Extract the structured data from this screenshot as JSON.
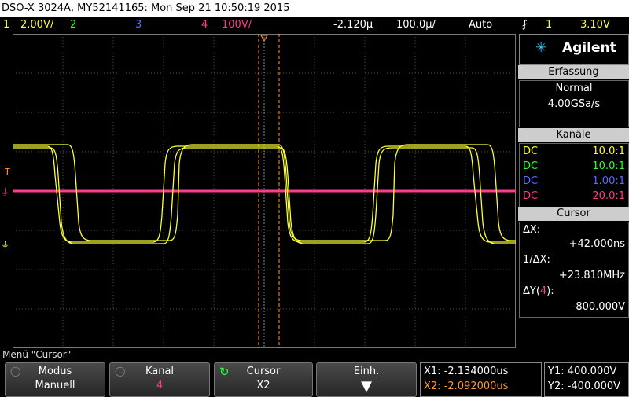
{
  "title": "DSO-X 3024A, MY52141165: Mon Sep 21 10:50:19 2015",
  "top_bar": {
    "ch1_num": "1",
    "ch1_scale": "2.00V/",
    "ch2_num": "2",
    "ch3_num": "3",
    "ch4_num": "4",
    "ch4_scale": "100V/",
    "time_offset": "-2.120µ",
    "time_scale": "100.0µ/",
    "trigger_mode": "Auto",
    "trigger_symbol": "⨏",
    "trigger_channel": "1",
    "trigger_level": "3.10V"
  },
  "colors": {
    "ch1": "#ffff33",
    "ch2": "#33ff33",
    "ch3": "#5a6bff",
    "ch4": "#ff3b8e",
    "cursor": "#ff9933",
    "grid": "#555555"
  },
  "markers": {
    "trigger_marker": "T",
    "ch4_marker": "4",
    "ch1_marker": "1"
  },
  "side_panel": {
    "brand": "Agilent",
    "acquisition_header": "Erfassung",
    "acq_mode": "Normal",
    "sample_rate": "4.00GSa/s",
    "channels_header": "Kanäle",
    "channels": [
      {
        "coupling": "DC",
        "probe": "10.0:1",
        "color": "#ffff33"
      },
      {
        "coupling": "DC",
        "probe": "10.0:1",
        "color": "#33ff33"
      },
      {
        "coupling": "DC",
        "probe": "1.00:1",
        "color": "#5a6bff"
      },
      {
        "coupling": "DC",
        "probe": "20.0:1",
        "color": "#ff3b8e"
      }
    ],
    "cursor_header": "Cursor",
    "delta_x_label": "ΔX:",
    "delta_x_value": "+42.000ns",
    "inv_delta_x_label": "1/ΔX:",
    "inv_delta_x_value": "+23.810MHz",
    "delta_y_label_prefix": "ΔY(",
    "delta_y_channel": "4",
    "delta_y_label_suffix": "):",
    "delta_y_value": "-800.000V"
  },
  "menu": {
    "label": "Menü \"Cursor\""
  },
  "softkeys": [
    {
      "title": "Modus",
      "value": "Manuell"
    },
    {
      "title": "Kanal",
      "value": "4"
    },
    {
      "title": "Cursor",
      "value": "X2"
    },
    {
      "title": "Einh.",
      "value": ""
    }
  ],
  "readouts": {
    "x1": "X1: -2.134000us",
    "x2": "X2: -2.092000us",
    "y1": "Y1: 400.000V",
    "y2": "Y2: -400.000V"
  }
}
